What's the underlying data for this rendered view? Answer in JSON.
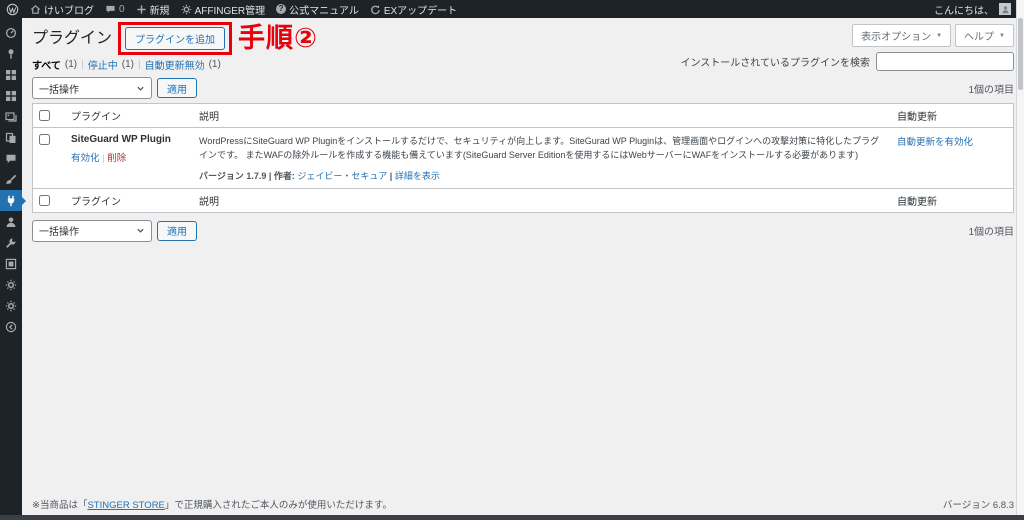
{
  "admin_bar": {
    "site": "けいブログ",
    "comments": "0",
    "new": "新規",
    "affinger": "AFFINGER管理",
    "manual": "公式マニュアル",
    "ex_update": "EXアップデート",
    "greeting": "こんにちは、"
  },
  "screen_meta": {
    "options": "表示オプション",
    "help": "ヘルプ",
    "arrow": "▼"
  },
  "page": {
    "title": "プラグイン",
    "add_button": "プラグインを追加",
    "annotation": "手順②"
  },
  "filters": {
    "all": "すべて",
    "all_count": "(1)",
    "inactive": "停止中",
    "inactive_count": "(1)",
    "auto_disabled": "自動更新無効",
    "auto_disabled_count": "(1)",
    "sep": "|"
  },
  "search": {
    "label": "インストールされているプラグインを検索",
    "value": ""
  },
  "tablenav": {
    "bulk": "一括操作",
    "apply": "適用",
    "count": "1個の項目"
  },
  "table": {
    "col_plugin": "プラグイン",
    "col_desc": "説明",
    "col_auto": "自動更新",
    "row": {
      "name": "SiteGuard WP Plugin",
      "activate": "有効化",
      "delete": "削除",
      "sep": "|",
      "description": "WordPressにSiteGuard WP Pluginをインストールするだけで、セキュリティが向上します。SiteGurad WP Pluginは、管理画面やログインへの攻撃対策に特化したプラグインです。 またWAFの除外ルールを作成する機能も備えています(SiteGuard Server Editionを使用するにはWebサーバーにWAFをインストールする必要があります)",
      "version": "バージョン 1.7.9",
      "author_label": "作者:",
      "author": "ジェイビー・セキュア",
      "details": "詳細を表示",
      "auto_update_action": "自動更新を有効化"
    }
  },
  "footer": {
    "note_prefix": "※当商品は「",
    "note_link": "STINGER STORE",
    "note_suffix": "」で正規購入されたご本人のみが使用いただけます。",
    "version": "バージョン 6.8.3"
  },
  "sidebar": {
    "icons": [
      "dashboard-icon",
      "pushpin-icon",
      "grid-icon",
      "grid-icon",
      "images-icon",
      "pages-icon",
      "comments-icon",
      "brush-icon",
      "plug-icon",
      "user-icon",
      "wrench-icon",
      "box-icon",
      "gear-icon",
      "gear-icon",
      "collapse-icon"
    ],
    "active_icon": "plug-icon"
  },
  "colors": {
    "adminbar_bg": "#1d2327",
    "body_bg": "#f0f0f1",
    "link": "#2271b1",
    "delete_link": "#b32d2e",
    "annotation_red": "#e8000d",
    "active_menu": "#2271b1"
  }
}
